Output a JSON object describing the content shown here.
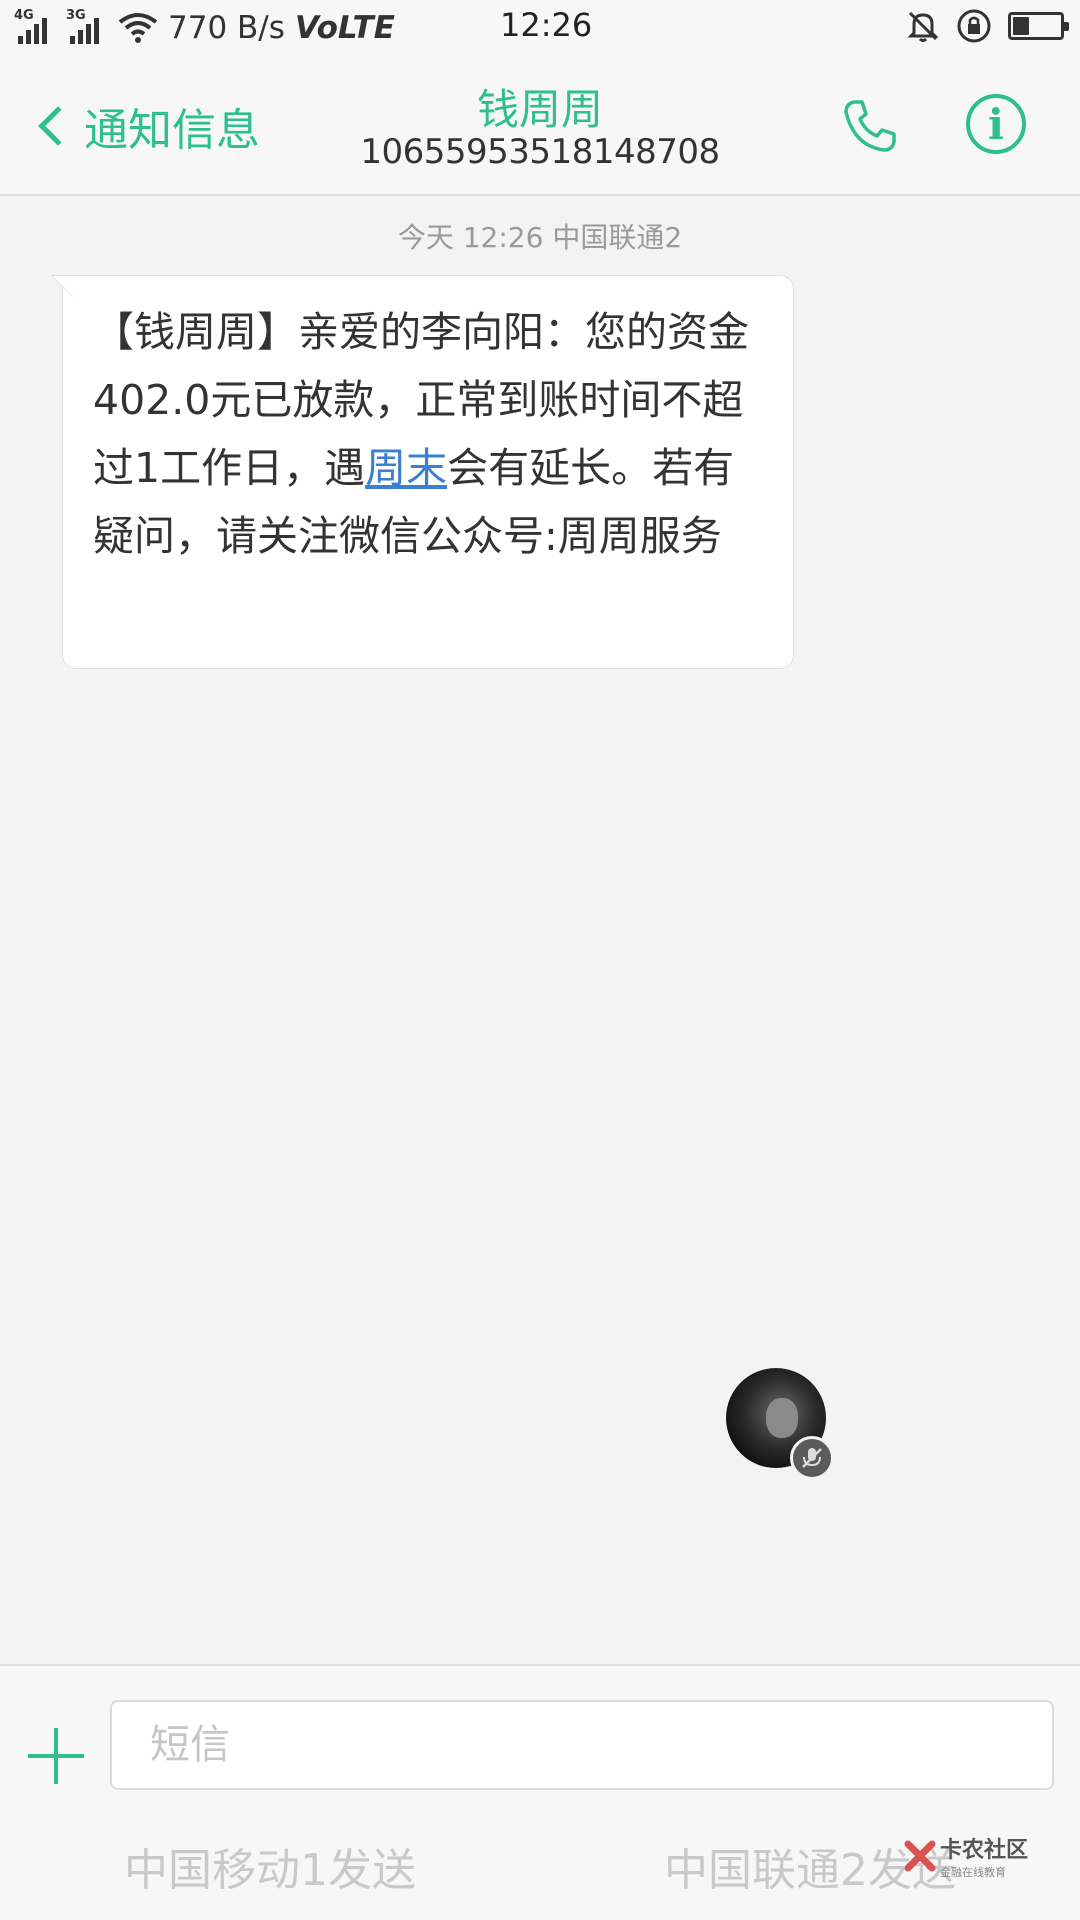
{
  "status_bar": {
    "sim1_tag": "4G",
    "sim2_tag": "3G",
    "net_speed": "770 B/s",
    "volte": "VoLTE",
    "time": "12:26",
    "battery_level": 0.35
  },
  "header": {
    "back_label": "通知信息",
    "contact_name": "钱周周",
    "contact_number": "10655953518148708",
    "accent_color": "#2fbe8f"
  },
  "conversation": {
    "date_line": "今天 12:26  中国联通2",
    "message": {
      "part1": "【钱周周】亲爱的李向阳：您的资金402.0元已放款，正常到账时间不超过1工作日，遇",
      "link": "周末",
      "part2": "会有延长。若有疑问，请关注微信公众号:周周服务"
    }
  },
  "composer": {
    "placeholder": "短信",
    "send_sim1": "中国移动1发送",
    "send_sim2": "中国联通2发送"
  },
  "watermark": {
    "main": "卡农社区",
    "sub": "金融在线教育"
  },
  "icons": [
    "signal-icon",
    "wifi-icon",
    "mute-bell-icon",
    "rotation-lock-icon",
    "battery-icon",
    "back-chevron-icon",
    "phone-icon",
    "info-icon",
    "plus-icon",
    "mic-mute-icon"
  ]
}
